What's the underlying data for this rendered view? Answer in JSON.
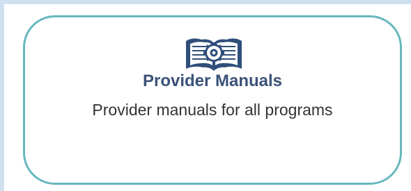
{
  "card": {
    "icon": "open-book-gear-icon",
    "title": "Provider Manuals",
    "description": "Provider manuals for all programs"
  },
  "colors": {
    "background": "#cfe0f1",
    "card_border": "#67b7bf",
    "title_text": "#3b5279",
    "icon": "#2f4f7b",
    "description_text": "#333333"
  }
}
